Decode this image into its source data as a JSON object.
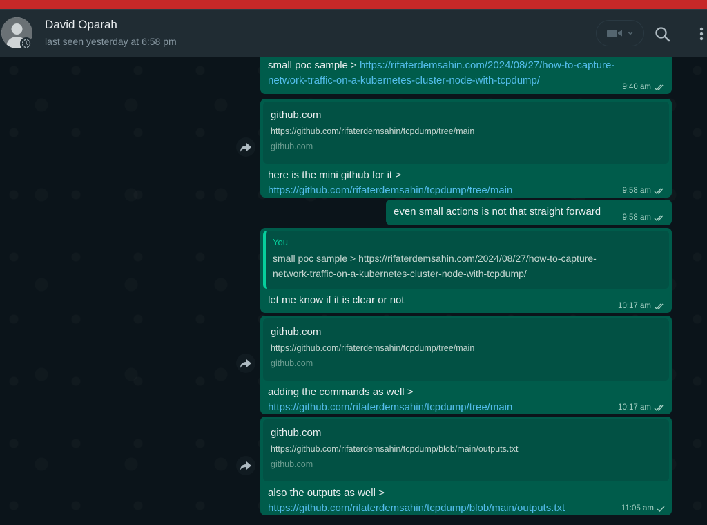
{
  "contact": {
    "name": "David Oparah",
    "status": "last seen yesterday at 6:58 pm"
  },
  "icons": {
    "video": "video-call-icon",
    "dropdown": "chevron-down-icon",
    "search": "search-icon",
    "menu": "menu-icon",
    "forward": "forward-icon",
    "double_check": "double-check-icon",
    "single_check": "single-check-icon"
  },
  "colors": {
    "outgoing_bubble": "#005c4b",
    "link": "#53bdeb",
    "header": "#202c33",
    "background": "#0b141a"
  },
  "messages": [
    {
      "text": "small poc sample > ",
      "link": "https://rifaterdemsahin.com/2024/08/27/how-to-capture-network-traffic-on-a-kubernetes-cluster-node-with-tcpdump/",
      "time": "9:40 am",
      "status": "read"
    },
    {
      "preview": {
        "title": "github.com",
        "url": "https://github.com/rifaterdemsahin/tcpdump/tree/main",
        "domain": "github.com"
      },
      "text": "here is the mini github for it > ",
      "link": "https://github.com/rifaterdemsahin/tcpdump/tree/main",
      "time": "9:58 am",
      "status": "read"
    },
    {
      "text": "even small actions is not that straight forward",
      "time": "9:58 am",
      "status": "read"
    },
    {
      "quote": {
        "author": "You",
        "text": "small poc sample > https://rifaterdemsahin.com/2024/08/27/how-to-capture-network-traffic-on-a-kubernetes-cluster-node-with-tcpdump/"
      },
      "text": "let me know if it is clear or not",
      "time": "10:17 am",
      "status": "read"
    },
    {
      "preview": {
        "title": "github.com",
        "url": "https://github.com/rifaterdemsahin/tcpdump/tree/main",
        "domain": "github.com"
      },
      "text": "adding the commands as well > ",
      "link": "https://github.com/rifaterdemsahin/tcpdump/tree/main",
      "time": "10:17 am",
      "status": "read"
    },
    {
      "preview": {
        "title": "github.com",
        "url": "https://github.com/rifaterdemsahin/tcpdump/blob/main/outputs.txt",
        "domain": "github.com"
      },
      "text": "also the outputs as well > ",
      "link": "https://github.com/rifaterdemsahin/tcpdump/blob/main/outputs.txt",
      "time": "11:05 am",
      "status": "sent"
    }
  ]
}
